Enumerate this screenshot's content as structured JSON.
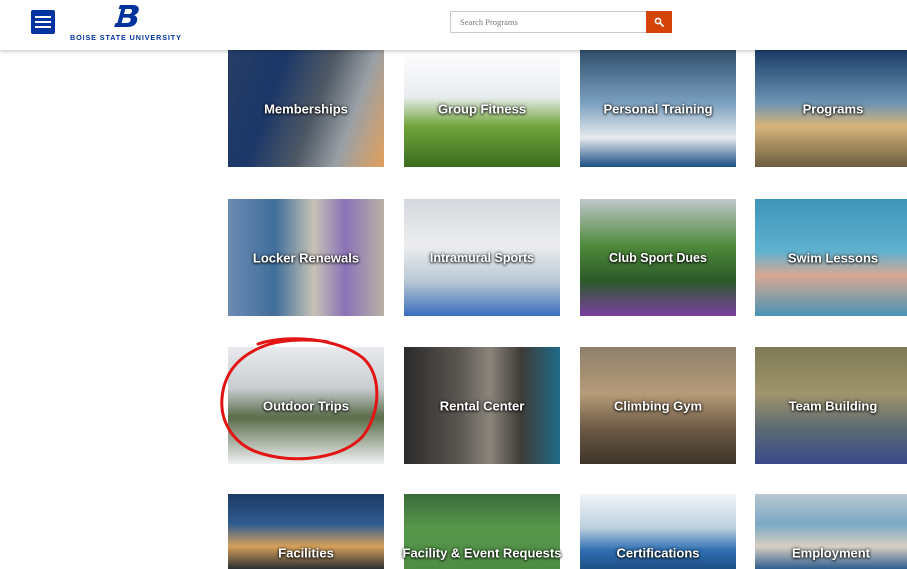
{
  "header": {
    "logo_text": "BOISE STATE UNIVERSITY",
    "search_placeholder": "Search Programs"
  },
  "colors": {
    "brand_blue": "#0033a0",
    "search_button": "#d64309",
    "annotation_red": "#e21414"
  },
  "icons": {
    "menu": "hamburger-icon",
    "search": "magnifier-icon",
    "logo": "bronco-b-logo"
  },
  "tiles": [
    {
      "label": "Memberships"
    },
    {
      "label": "Group Fitness"
    },
    {
      "label": "Personal Training"
    },
    {
      "label": "Programs"
    },
    {
      "label": "Locker Renewals"
    },
    {
      "label": "Intramural Sports"
    },
    {
      "label": "Club Sport Dues"
    },
    {
      "label": "Swim Lessons"
    },
    {
      "label": "Outdoor Trips"
    },
    {
      "label": "Rental Center"
    },
    {
      "label": "Climbing Gym"
    },
    {
      "label": "Team Building"
    },
    {
      "label": "Facilities"
    },
    {
      "label": "Facility & Event Requests"
    },
    {
      "label": "Certifications"
    },
    {
      "label": "Employment"
    }
  ]
}
